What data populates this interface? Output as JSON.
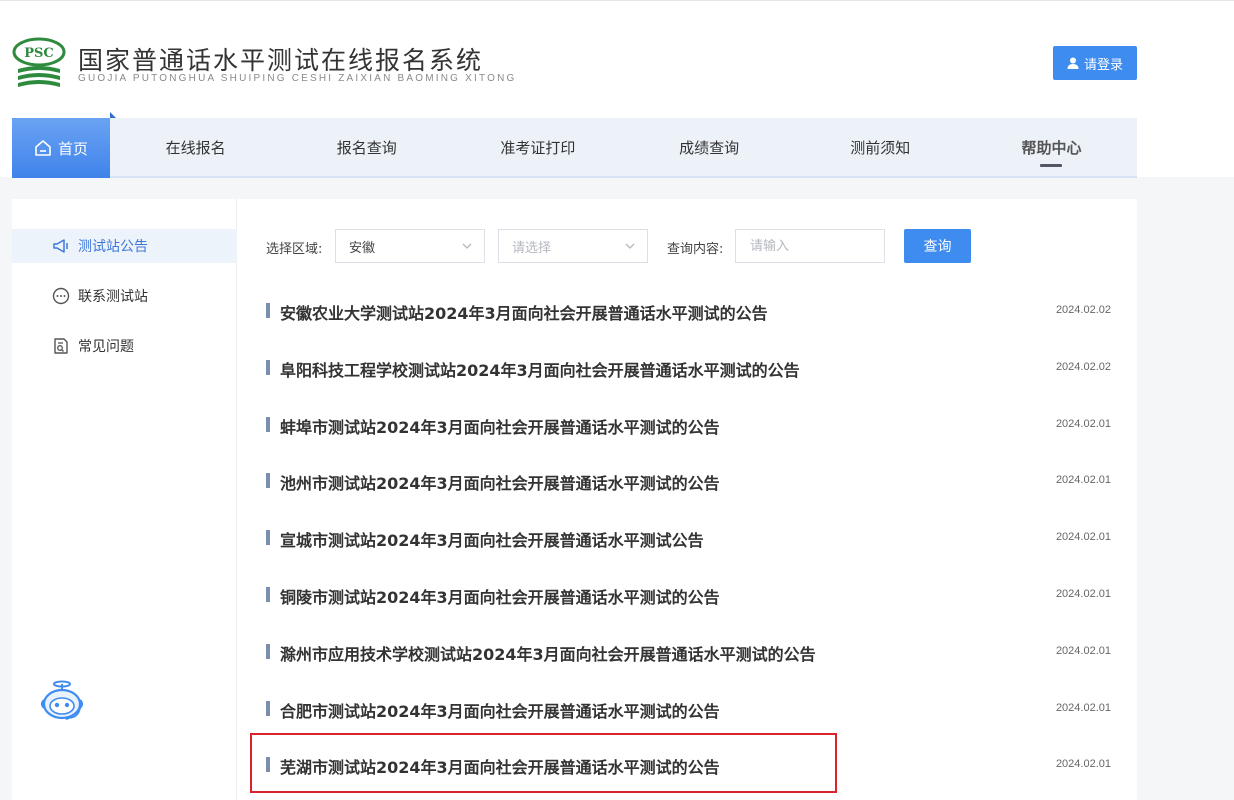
{
  "header": {
    "logo_badge": "PSC",
    "title": "国家普通话水平测试在线报名系统",
    "subtitle": "GUOJIA PUTONGHUA SHUIPING CESHI ZAIXIAN BAOMING XITONG",
    "login_label": "请登录"
  },
  "nav": {
    "home": "首页",
    "items": [
      "在线报名",
      "报名查询",
      "准考证打印",
      "成绩查询",
      "测前须知",
      "帮助中心"
    ],
    "active": "帮助中心"
  },
  "sidebar": {
    "items": [
      {
        "label": "测试站公告",
        "icon": "megaphone-icon",
        "active": true
      },
      {
        "label": "联系测试站",
        "icon": "chat-bubble-icon",
        "active": false
      },
      {
        "label": "常见问题",
        "icon": "document-search-icon",
        "active": false
      }
    ]
  },
  "filter": {
    "region_label": "选择区域:",
    "province_value": "安徽",
    "city_placeholder": "请选择",
    "query_label": "查询内容:",
    "query_placeholder": "请输入",
    "search_label": "查询"
  },
  "notices": [
    {
      "title": "安徽农业大学测试站2024年3月面向社会开展普通话水平测试的公告",
      "date": "2024.02.02"
    },
    {
      "title": "阜阳科技工程学校测试站2024年3月面向社会开展普通话水平测试的公告",
      "date": "2024.02.02"
    },
    {
      "title": "蚌埠市测试站2024年3月面向社会开展普通话水平测试的公告",
      "date": "2024.02.01"
    },
    {
      "title": "池州市测试站2024年3月面向社会开展普通话水平测试的公告",
      "date": "2024.02.01"
    },
    {
      "title": "宣城市测试站2024年3月面向社会开展普通话水平测试公告",
      "date": "2024.02.01"
    },
    {
      "title": "铜陵市测试站2024年3月面向社会开展普通话水平测试的公告",
      "date": "2024.02.01"
    },
    {
      "title": "滁州市应用技术学校测试站2024年3月面向社会开展普通话水平测试的公告",
      "date": "2024.02.01"
    },
    {
      "title": "合肥市测试站2024年3月面向社会开展普通话水平测试的公告",
      "date": "2024.02.01"
    },
    {
      "title": "芜湖市测试站2024年3月面向社会开展普通话水平测试的公告",
      "date": "2024.02.01"
    }
  ],
  "colors": {
    "accent": "#3f8cf0",
    "highlight_box": "#d9242c",
    "logo_green": "#2e8b3e"
  }
}
